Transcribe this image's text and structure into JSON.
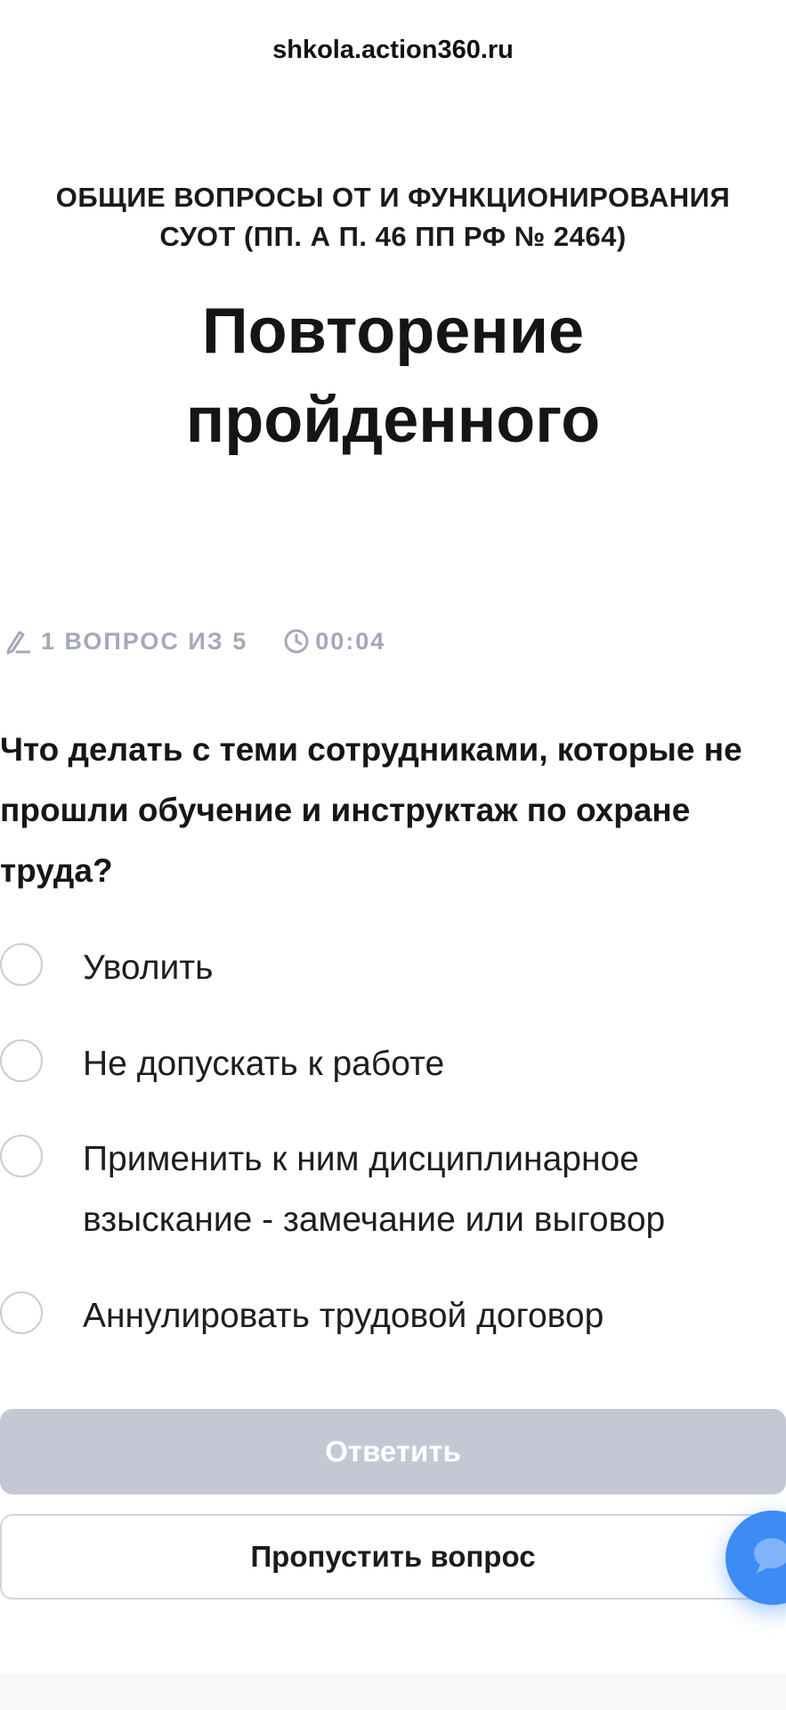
{
  "browser": {
    "url": "shkola.action360.ru"
  },
  "course": {
    "title": "ОБЩИЕ ВОПРОСЫ ОТ И ФУНКЦИОНИРОВАНИЯ СУОТ (ПП. А П. 46 ПП РФ № 2464)"
  },
  "lesson": {
    "title": "Повторение пройденного"
  },
  "meta": {
    "question_counter": "1 ВОПРОС ИЗ 5",
    "timer": "00:04",
    "color": "#a3a9b8"
  },
  "question": {
    "text": "Что делать с теми сотрудниками, которые не прошли обучение и инструктаж по охране труда?",
    "options": [
      {
        "label": "Уволить"
      },
      {
        "label": "Не допускать к работе"
      },
      {
        "label": "Применить к ним дисциплинарное взыскание - замечание или выговор"
      },
      {
        "label": "Аннулировать трудовой договор"
      }
    ]
  },
  "actions": {
    "answer_label": "Ответить",
    "skip_label": "Пропустить вопрос"
  },
  "colors": {
    "answer_button_disabled": "#c4c8d4",
    "chat_button": "#3d8bf5"
  },
  "icons": {
    "question_counter": "pencil-icon",
    "timer": "clock-icon",
    "chat": "chat-bubble-icon"
  }
}
